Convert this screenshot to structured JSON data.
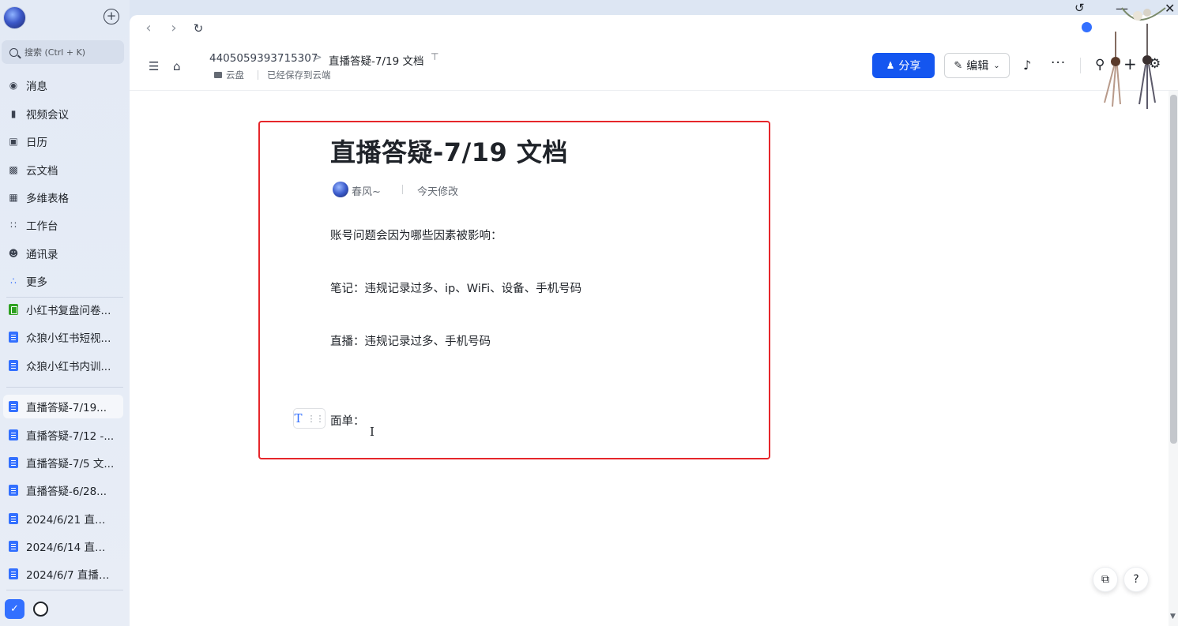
{
  "sidebar": {
    "search_placeholder": "搜索 (Ctrl + K)",
    "nav": [
      {
        "label": "消息",
        "icon": "chat-bubbles-icon"
      },
      {
        "label": "视频会议",
        "icon": "video-camera-icon"
      },
      {
        "label": "日历",
        "icon": "calendar-icon"
      },
      {
        "label": "云文档",
        "icon": "cloud-docs-icon"
      },
      {
        "label": "多维表格",
        "icon": "base-table-icon"
      },
      {
        "label": "工作台",
        "icon": "workplace-grid-icon"
      },
      {
        "label": "通讯录",
        "icon": "contacts-icon"
      },
      {
        "label": "更多",
        "icon": "more-apps-icon"
      }
    ],
    "pinned": [
      {
        "label": "小红书复盘问卷...",
        "icon": "sheet-icon"
      },
      {
        "label": "众狼小红书短视...",
        "icon": "doc-icon"
      },
      {
        "label": "众狼小红书内训...",
        "icon": "doc-icon"
      }
    ],
    "recent": [
      {
        "label": "直播答疑-7/19...",
        "icon": "doc-icon",
        "active": true
      },
      {
        "label": "直播答疑-7/12 -...",
        "icon": "doc-icon"
      },
      {
        "label": "直播答疑-7/5 文...",
        "icon": "doc-icon"
      },
      {
        "label": "直播答疑-6/28...",
        "icon": "doc-icon"
      },
      {
        "label": "2024/6/21 直播...",
        "icon": "doc-icon"
      },
      {
        "label": "2024/6/14 直播...",
        "icon": "doc-icon"
      },
      {
        "label": "2024/6/7 直播复...",
        "icon": "doc-icon"
      }
    ]
  },
  "header": {
    "workspace_id": "4405059393715307",
    "breadcrumb_separator": ">",
    "doc_title": "直播答疑-7/19 文档",
    "location": "云盘",
    "save_status": "已经保存到云端",
    "share_label": "分享",
    "edit_label": "编辑"
  },
  "document": {
    "title": "直播答疑-7/19 文档",
    "author": "春风~",
    "modified": "今天修改",
    "paragraphs": [
      "账号问题会因为哪些因素被影响：",
      "笔记：违规记录过多、ip、WiFi、设备、手机号码",
      "直播：违规记录过多、手机号码",
      "面单："
    ]
  },
  "colors": {
    "accent": "#1456f0",
    "highlight_border": "#e6262b",
    "doc_icon": "#3370ff",
    "sheet_icon": "#2ea121"
  }
}
